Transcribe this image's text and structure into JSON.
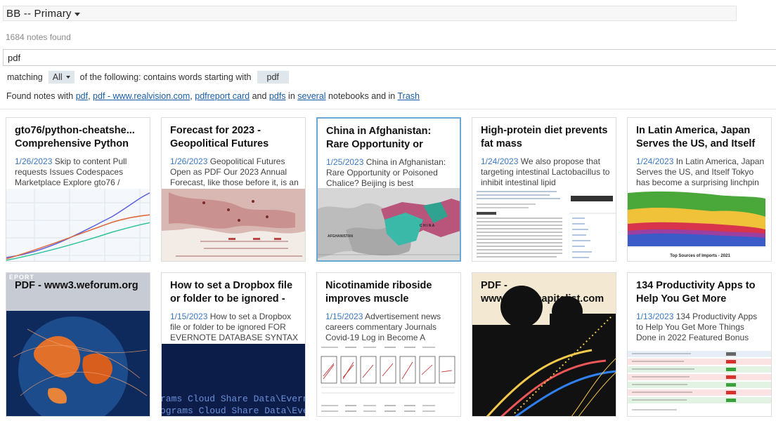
{
  "header": {
    "notebook_title": "BB  --  Primary"
  },
  "results": {
    "count_text": "1684 notes found"
  },
  "search": {
    "value": "pdf"
  },
  "match": {
    "prefix": "matching",
    "scope": "All",
    "middle": "of the following:  contains words starting with",
    "term": "pdf"
  },
  "found": {
    "prefix": "Found notes with",
    "tag1": "pdf",
    "sep1": ",",
    "tag2": "pdf - www.realvision.com",
    "sep2": ",",
    "tag3": "pdfreport card",
    "and": "and",
    "tag4": "pdfs",
    "in": "in",
    "several": "several",
    "notebooks_and_in": "notebooks and in",
    "trash": "Trash"
  },
  "cards": [
    {
      "title": "gto76/python-cheatshe... Comprehensive Python",
      "date": "1/26/2023",
      "snippet": " Skip to content Pull requests Issues Codespaces Marketplace Explore gto76 /"
    },
    {
      "title": "Forecast for 2023 - Geopolitical Futures",
      "date": "1/26/2023",
      "snippet": " Geopolitical Futures Open as PDF Our 2023 Annual Forecast, like those before it, is an"
    },
    {
      "title": "China in Afghanistan: Rare Opportunity or",
      "date": "1/25/2023",
      "snippet": " China in Afghanistan: Rare Opportunity or Poisoned Chalice? Beijing is best positioned"
    },
    {
      "title": "High-protein diet prevents fat mass",
      "date": "1/24/2023",
      "snippet": " We also propose that targeting intestinal Lactobacillus to inhibit intestinal lipid"
    },
    {
      "title": "In Latin America, Japan Serves the US, and Itself",
      "date": "1/24/2023",
      "snippet": " In Latin America, Japan Serves the US, and Itself Tokyo has become a surprising linchpin of"
    },
    {
      "title": "PDF - www3.weforum.org",
      "date": "",
      "snippet": ""
    },
    {
      "title": "How to set a Dropbox file or folder to be ignored -",
      "date": "1/15/2023",
      "snippet": " How to set a Dropbox file or folder to be ignored FOR EVERNOTE DATABASE SYNTAX"
    },
    {
      "title": "Nicotinamide riboside improves muscle",
      "date": "1/15/2023",
      "snippet": " Advertisement news careers commentary Journals Covid-19 Log in Become A"
    },
    {
      "title": "PDF - www.visualcapitalist.com",
      "date": "",
      "snippet": ""
    },
    {
      "title": "134 Productivity Apps to Help You Get More",
      "date": "1/13/2023",
      "snippet": " 134 Productivity Apps to Help You Get More Things Done in 2022 Featured Bonus"
    }
  ],
  "thumb_text": {
    "map_neighbor": "AFGHANISTAN",
    "map_country": "C H I N A",
    "dropbox_line1": "rams Cloud Share Data\\Everno",
    "dropbox_line2": "ograms Cloud Share Data\\Everno",
    "weforum_corner": "EPORT",
    "chart_caption": "Top Sources of Imports - 2021"
  }
}
